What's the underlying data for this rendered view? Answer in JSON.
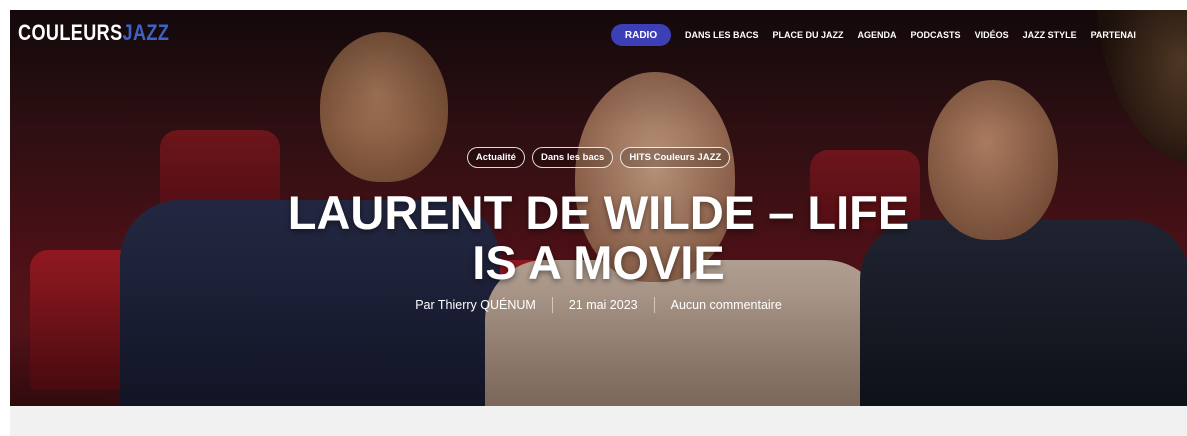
{
  "logo": {
    "part1": "COULEURS",
    "part2": "JAZZ"
  },
  "nav": {
    "radio": "RADIO",
    "items": [
      "DANS LES BACS",
      "PLACE DU JAZZ",
      "AGENDA",
      "PODCASTS",
      "VIDÉOS",
      "JAZZ STYLE",
      "PARTENAI"
    ]
  },
  "tags": [
    "Actualité",
    "Dans les bacs",
    "HITS Couleurs JAZZ"
  ],
  "title": {
    "line1": "LAURENT DE WILDE – LIFE",
    "line2": "IS A MOVIE"
  },
  "meta": {
    "author": "Par Thierry QUÉNUM",
    "date": "21 mai 2023",
    "comments": "Aucun commentaire"
  },
  "colors": {
    "radio_button": "#3c3fb6",
    "logo_accent": "#3f62c9",
    "footer_bar": "#f1f1f1"
  }
}
